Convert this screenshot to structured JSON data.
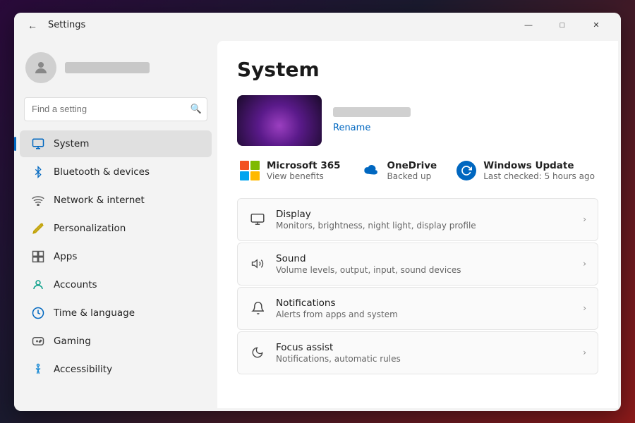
{
  "window": {
    "title": "Settings",
    "controls": {
      "minimize": "—",
      "maximize": "□",
      "close": "✕"
    }
  },
  "sidebar": {
    "search_placeholder": "Find a setting",
    "search_icon": "🔍",
    "nav_items": [
      {
        "id": "system",
        "label": "System",
        "icon": "💻",
        "active": true
      },
      {
        "id": "bluetooth",
        "label": "Bluetooth & devices",
        "icon": "🔵"
      },
      {
        "id": "network",
        "label": "Network & internet",
        "icon": "📶"
      },
      {
        "id": "personalization",
        "label": "Personalization",
        "icon": "✏️"
      },
      {
        "id": "apps",
        "label": "Apps",
        "icon": "🧩"
      },
      {
        "id": "accounts",
        "label": "Accounts",
        "icon": "👤",
        "annotated": true
      },
      {
        "id": "time",
        "label": "Time & language",
        "icon": "🌐"
      },
      {
        "id": "gaming",
        "label": "Gaming",
        "icon": "🎮"
      },
      {
        "id": "accessibility",
        "label": "Accessibility",
        "icon": "♿"
      }
    ]
  },
  "main": {
    "title": "System",
    "hero": {
      "rename_label": "Rename"
    },
    "apps_row": [
      {
        "id": "microsoft365",
        "name": "Microsoft 365",
        "sub": "View benefits",
        "icon_type": "ms365"
      },
      {
        "id": "onedrive",
        "name": "OneDrive",
        "sub": "Backed up",
        "icon_type": "onedrive"
      },
      {
        "id": "windowsupdate",
        "name": "Windows Update",
        "sub": "Last checked: 5 hours ago",
        "icon_type": "winupdate"
      }
    ],
    "settings_items": [
      {
        "id": "display",
        "name": "Display",
        "desc": "Monitors, brightness, night light, display profile",
        "icon": "🖥"
      },
      {
        "id": "sound",
        "name": "Sound",
        "desc": "Volume levels, output, input, sound devices",
        "icon": "🔊"
      },
      {
        "id": "notifications",
        "name": "Notifications",
        "desc": "Alerts from apps and system",
        "icon": "🔔"
      },
      {
        "id": "focus",
        "name": "Focus assist",
        "desc": "Notifications, automatic rules",
        "icon": "🌙"
      }
    ]
  }
}
